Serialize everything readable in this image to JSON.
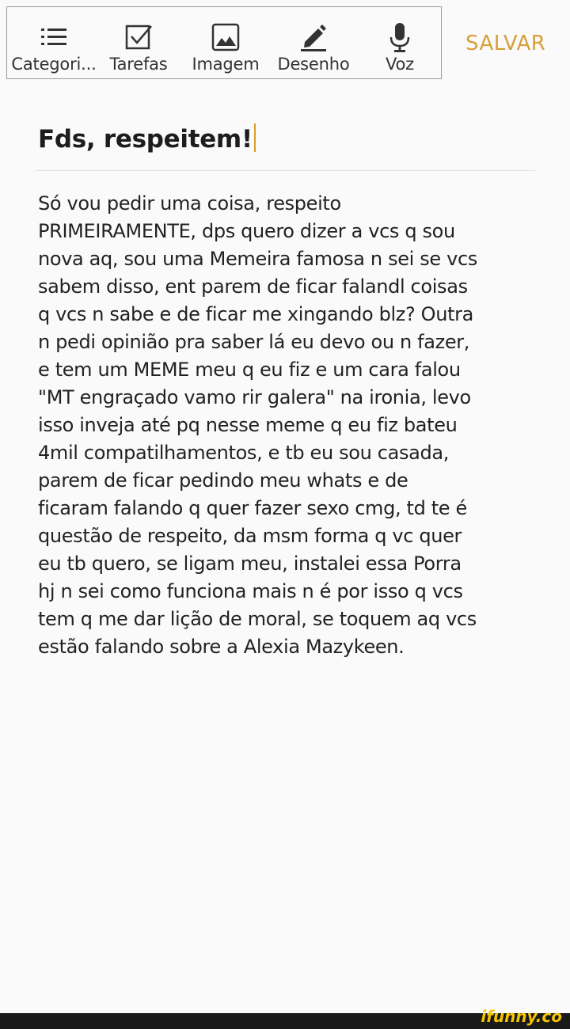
{
  "toolbar": {
    "items": [
      {
        "label": "Categori...",
        "icon": "list-icon"
      },
      {
        "label": "Tarefas",
        "icon": "checkbox-icon"
      },
      {
        "label": "Imagem",
        "icon": "image-icon"
      },
      {
        "label": "Desenho",
        "icon": "pen-icon"
      },
      {
        "label": "Voz",
        "icon": "microphone-icon"
      }
    ],
    "save_label": "SALVAR"
  },
  "note": {
    "title": "Fds, respeitem!",
    "lines": [
      "Só vou pedir uma coisa, respeito",
      "PRIMEIRAMENTE, dps quero dizer a vcs q sou",
      "nova aq, sou uma Memeira famosa n sei se vcs",
      "sabem disso, ent parem de ficar falandl coisas",
      "q vcs n sabe e de ficar me xingando blz? Outra",
      "n pedi opinião  pra saber lá eu devo ou n fazer,",
      "e tem um MEME meu q eu fiz e um cara falou",
      "\"MT engraçado vamo rir galera\" na ironia, levo",
      "isso inveja até pq nesse meme q eu fiz bateu",
      "4mil compatilhamentos, e tb eu sou casada,",
      "parem de ficar pedindo meu whats e de",
      "ficaram falando q quer fazer sexo cmg, td te é",
      "questão de respeito, da msm forma q vc quer",
      "eu tb quero, se ligam meu, instalei essa Porra",
      "hj n sei como funciona mais n é por isso q vcs",
      "tem q me dar lição de moral, se toquem aq vcs",
      "estão falando sobre a Alexia Mazykeen."
    ]
  },
  "watermark": "ifunny.co",
  "colors": {
    "accent": "#d6a03a",
    "cursor": "#e09a2a",
    "icon": "#333333",
    "background": "#fafafa"
  }
}
